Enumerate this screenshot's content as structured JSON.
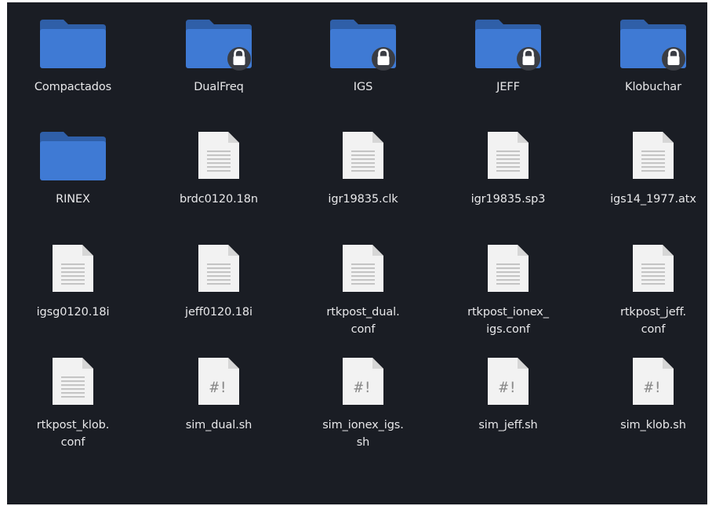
{
  "files": {
    "items": [
      {
        "name": "Compactados",
        "type": "folder",
        "locked": false
      },
      {
        "name": "DualFreq",
        "type": "folder",
        "locked": true
      },
      {
        "name": "IGS",
        "type": "folder",
        "locked": true
      },
      {
        "name": "JEFF",
        "type": "folder",
        "locked": true
      },
      {
        "name": "Klobuchar",
        "type": "folder",
        "locked": true
      },
      {
        "name": "RINEX",
        "type": "folder",
        "locked": false
      },
      {
        "name": "brdc0120.18n",
        "type": "text-file",
        "locked": false
      },
      {
        "name": "igr19835.clk",
        "type": "text-file",
        "locked": false
      },
      {
        "name": "igr19835.sp3",
        "type": "text-file",
        "locked": false
      },
      {
        "name": "igs14_1977.atx",
        "type": "text-file",
        "locked": false
      },
      {
        "name": "igsg0120.18i",
        "type": "text-file",
        "locked": false
      },
      {
        "name": "jeff0120.18i",
        "type": "text-file",
        "locked": false
      },
      {
        "name": "rtkpost_dual.\nconf",
        "type": "text-file",
        "locked": false
      },
      {
        "name": "rtkpost_ionex_\nigs.conf",
        "type": "text-file",
        "locked": false
      },
      {
        "name": "rtkpost_jeff.\nconf",
        "type": "text-file",
        "locked": false
      },
      {
        "name": "rtkpost_klob.\nconf",
        "type": "text-file",
        "locked": false
      },
      {
        "name": "sim_dual.sh",
        "type": "script-file",
        "locked": false
      },
      {
        "name": "sim_ionex_igs.\nsh",
        "type": "script-file",
        "locked": false
      },
      {
        "name": "sim_jeff.sh",
        "type": "script-file",
        "locked": false
      },
      {
        "name": "sim_klob.sh",
        "type": "script-file",
        "locked": false
      }
    ]
  },
  "icons": {
    "folder": "folder-icon",
    "lock": "lock-icon",
    "text-file": "text-file-icon",
    "script-file": "script-file-icon",
    "script_glyph": "#!"
  },
  "colors": {
    "background": "#1a1d24",
    "folder_back": "#2f5fa8",
    "folder_front": "#3f7ad4",
    "file_page": "#f2f2f2",
    "file_fold": "#d6d6d6",
    "label_text": "#e8e8ea",
    "lock_badge": "#3a3d44"
  }
}
